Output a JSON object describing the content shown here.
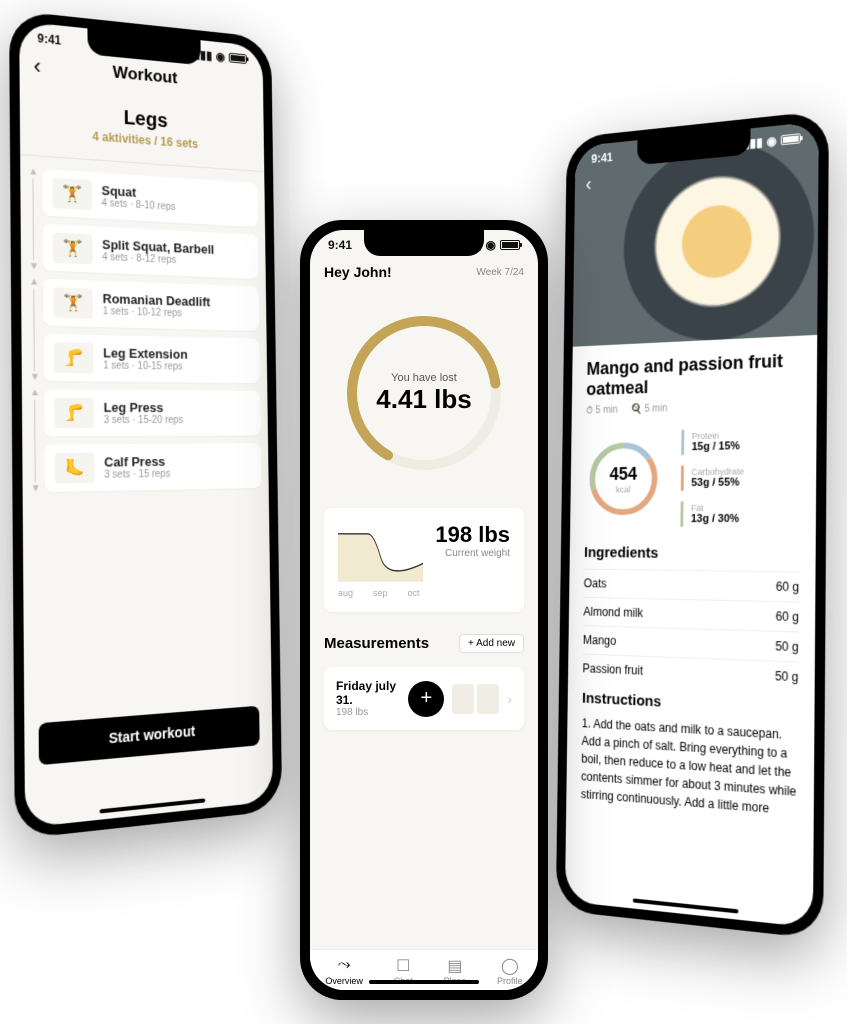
{
  "status": {
    "time": "9:41"
  },
  "phone1": {
    "header_title": "Workout",
    "section_title": "Legs",
    "section_sub": "4 aktivities / 16 sets",
    "exercises": [
      {
        "name": "Squat",
        "detail": "4 sets · 8-10 reps"
      },
      {
        "name": "Split Squat, Barbell",
        "detail": "4 sets · 8-12 reps"
      },
      {
        "name": "Romanian Deadlift",
        "detail": "1 sets · 10-12 reps"
      },
      {
        "name": "Leg Extension",
        "detail": "1 sets · 10-15 reps"
      },
      {
        "name": "Leg Press",
        "detail": "3 sets · 15-20 reps"
      },
      {
        "name": "Calf Press",
        "detail": "3 sets · 15 reps"
      }
    ],
    "start_button": "Start workout"
  },
  "phone2": {
    "greeting": "Hey John!",
    "week": "Week 7/24",
    "progress_label": "You have lost",
    "progress_value": "4.41 lbs",
    "current_weight": "198 lbs",
    "current_weight_label": "Current weight",
    "chart_months": [
      "aug",
      "sep",
      "oct"
    ],
    "measurements_title": "Measurements",
    "add_new": "+ Add new",
    "meas_date": "Friday july 31.",
    "meas_value": "198 lbs",
    "tabs": [
      {
        "label": "Overview"
      },
      {
        "label": "Chat"
      },
      {
        "label": "Plans"
      },
      {
        "label": "Profile"
      }
    ]
  },
  "phone3": {
    "title": "Mango and passion fruit oatmeal",
    "prep_time": "5 min",
    "cook_time": "5 min",
    "kcal_value": "454",
    "kcal_unit": "kcal",
    "macros": {
      "protein": {
        "label": "Protein",
        "value": "15g / 15%"
      },
      "carb": {
        "label": "Carbohydrate",
        "value": "53g / 55%"
      },
      "fat": {
        "label": "Fat",
        "value": "13g / 30%"
      }
    },
    "ingredients_h": "Ingredients",
    "ingredients": [
      {
        "name": "Oats",
        "amount": "60 g"
      },
      {
        "name": "Almond milk",
        "amount": "60 g"
      },
      {
        "name": "Mango",
        "amount": "50 g"
      },
      {
        "name": "Passion fruit",
        "amount": "50 g"
      }
    ],
    "instructions_h": "Instructions",
    "instructions": "1. Add the oats and milk to a saucepan. Add a pinch of salt. Bring everything to a boil, then reduce to a low heat and let the contents simmer for about 3 minutes while stirring continuously. Add a little more"
  },
  "chart_data": [
    {
      "type": "line",
      "categories": [
        "aug",
        "sep",
        "oct"
      ],
      "values": [
        200,
        198.5,
        198
      ],
      "title": "Current weight",
      "ylabel": "lbs"
    },
    {
      "type": "pie",
      "series": [
        {
          "name": "Protein",
          "values": [
            15
          ]
        },
        {
          "name": "Carbohydrate",
          "values": [
            55
          ]
        },
        {
          "name": "Fat",
          "values": [
            30
          ]
        }
      ],
      "title": "454 kcal"
    }
  ]
}
